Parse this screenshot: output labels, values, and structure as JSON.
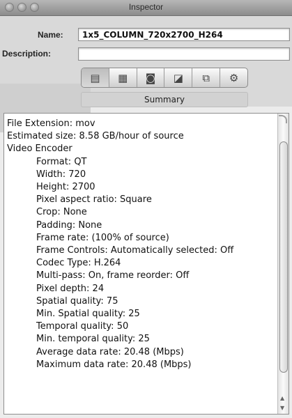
{
  "window": {
    "title": "Inspector"
  },
  "fields": {
    "name_label": "Name:",
    "name_value": "1x5_COLUMN_720x2700_H264",
    "description_label": "Description:",
    "description_value": ""
  },
  "toolbar": {
    "buttons": [
      {
        "icon": "summary-icon",
        "glyph": "▤"
      },
      {
        "icon": "encoder-icon",
        "glyph": "▦"
      },
      {
        "icon": "frame-controls-icon",
        "glyph": "◙"
      },
      {
        "icon": "filters-icon",
        "glyph": "◪"
      },
      {
        "icon": "geometry-icon",
        "glyph": "⧉"
      },
      {
        "icon": "actions-icon",
        "glyph": "⚙"
      }
    ]
  },
  "summary_tab": {
    "label": "Summary"
  },
  "summary": {
    "lines": [
      {
        "text": "File Extension: mov",
        "indent": false
      },
      {
        "text": "Estimated size: 8.58 GB/hour of source",
        "indent": false
      },
      {
        "text": "Video Encoder",
        "indent": false
      },
      {
        "text": "Format: QT",
        "indent": true
      },
      {
        "text": "Width: 720",
        "indent": true
      },
      {
        "text": "Height: 2700",
        "indent": true
      },
      {
        "text": "Pixel aspect ratio: Square",
        "indent": true
      },
      {
        "text": "Crop: None",
        "indent": true
      },
      {
        "text": "Padding: None",
        "indent": true
      },
      {
        "text": "Frame rate: (100% of source)",
        "indent": true
      },
      {
        "text": "Frame Controls: Automatically selected: Off",
        "indent": true
      },
      {
        "text": "Codec Type: H.264",
        "indent": true
      },
      {
        "text": "Multi-pass: On, frame reorder: Off",
        "indent": true
      },
      {
        "text": "Pixel depth: 24",
        "indent": true
      },
      {
        "text": "Spatial quality: 75",
        "indent": true
      },
      {
        "text": "Min. Spatial quality: 25",
        "indent": true
      },
      {
        "text": "Temporal quality: 50",
        "indent": true
      },
      {
        "text": "Min. temporal quality: 25",
        "indent": true
      },
      {
        "text": "Average data rate: 20.48 (Mbps)",
        "indent": true
      },
      {
        "text": "Maximum data rate: 20.48 (Mbps)",
        "indent": true
      }
    ]
  }
}
